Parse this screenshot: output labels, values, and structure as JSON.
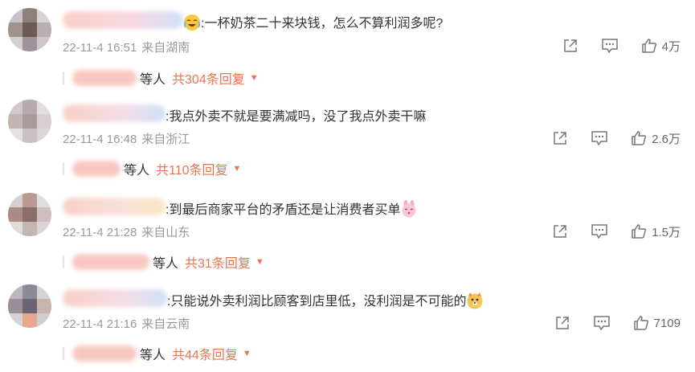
{
  "comments": [
    {
      "text": ":一杯奶茶二十来块钱，怎么不算利润多呢?",
      "emoji": "laughing-crying-emoji",
      "time": "22-11-4 16:51",
      "location": "来自湖南",
      "likes": "4万",
      "reply_suffix": "等人",
      "reply_count": "共304条回复"
    },
    {
      "text": ":我点外卖不就是要满减吗，没了我点外卖干嘛",
      "time": "22-11-4 16:48",
      "location": "来自浙江",
      "likes": "2.6万",
      "reply_suffix": "等人",
      "reply_count": "共110条回复"
    },
    {
      "text": ":到最后商家平台的矛盾还是让消费者买单",
      "emoji": "pink-bunny-emoji",
      "time": "22-11-4 21:28",
      "location": "来自山东",
      "likes": "1.5万",
      "reply_suffix": "等人",
      "reply_count": "共31条回复"
    },
    {
      "text": ":只能说外卖利润比顾客到店里低，没利润是不可能的",
      "emoji": "doge-emoji",
      "time": "22-11-4 21:16",
      "location": "来自云南",
      "likes": "7109",
      "reply_suffix": "等人",
      "reply_count": "共44条回复"
    }
  ],
  "colors": {
    "accent": "#eb7350",
    "meta": "#999999",
    "text": "#333333"
  },
  "icons": [
    "share-icon",
    "comment-icon",
    "like-icon",
    "chevron-down-icon"
  ]
}
